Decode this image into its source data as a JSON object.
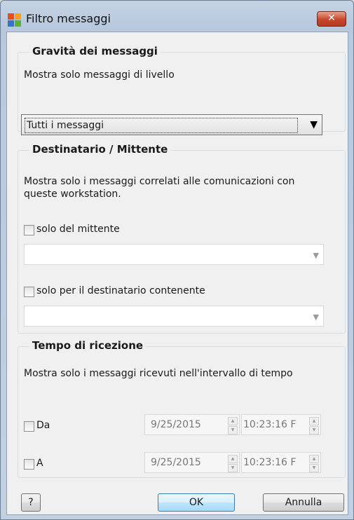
{
  "window": {
    "title": "Filtro messaggi",
    "close_glyph": "✕"
  },
  "severity": {
    "title": "Gravità dei messaggi",
    "desc": "Mostra solo messaggi di livello",
    "selected": "Tutti i messaggi"
  },
  "recipient": {
    "title": "Destinatario / Mittente",
    "desc1": "Mostra solo i messaggi correlati alle comunicazioni con",
    "desc2": "queste workstation.",
    "sender_label": "solo del mittente",
    "sender_value": "",
    "dest_label": "solo per il destinatario contenente",
    "dest_value": ""
  },
  "time": {
    "title": "Tempo di ricezione",
    "desc": "Mostra solo i messaggi ricevuti nell'intervallo di tempo",
    "from_label": "Da",
    "from_date": "9/25/2015",
    "from_time": "10:23:16 F",
    "to_label": "A",
    "to_date": "9/25/2015",
    "to_time": "10:23:16 F"
  },
  "buttons": {
    "help": "?",
    "ok": "OK",
    "cancel": "Annulla"
  },
  "icons": {
    "app": "avg-logo-icon",
    "dropdown": "chevron-down-icon",
    "spin_up": "spin-up-icon",
    "spin_down": "spin-down-icon"
  },
  "colors": {
    "title_bar": "#b7c8dd",
    "close": "#c6462b",
    "client": "#f0f0f0"
  }
}
